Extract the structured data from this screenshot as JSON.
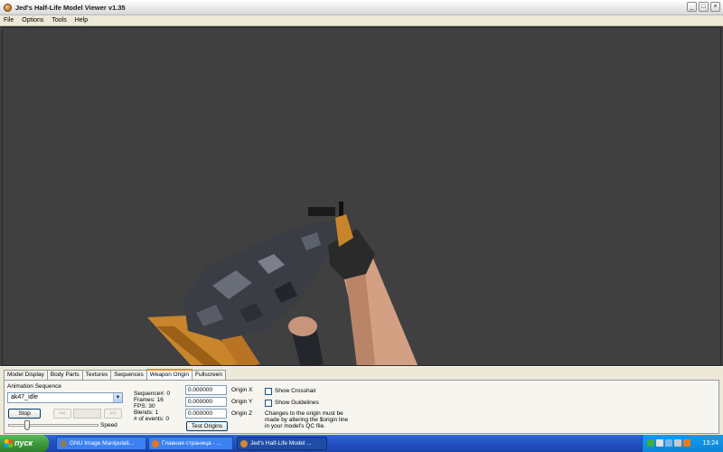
{
  "window": {
    "title": "Jed's Half-Life Model Viewer v1.35",
    "controls": [
      "_",
      "□",
      "×"
    ]
  },
  "menu": [
    "File",
    "Options",
    "Tools",
    "Help"
  ],
  "tabs": [
    "Model Display",
    "Body Parts",
    "Textures",
    "Sequences",
    "Weapon Origin",
    "Fullscreen"
  ],
  "active_tab": "Weapon Origin",
  "animation": {
    "label": "Animation Sequence",
    "selected": "ak47_idle",
    "stop_label": "Stop",
    "prev_label": "<<",
    "next_label": ">>",
    "speed_label": "Speed",
    "speed_value": 0.2
  },
  "info": {
    "sequence": "Sequence#: 0",
    "frames": "Frames: 16",
    "fps": "FPS: 30",
    "blends": "Blends: 1",
    "events": "# of events: 0"
  },
  "origin": {
    "x_value": "0.000000",
    "x_label": "Origin X",
    "y_value": "0.000000",
    "y_label": "Origin Y",
    "z_value": "0.000000",
    "z_label": "Origin Z",
    "test_label": "Test Origins"
  },
  "options": {
    "crosshair": "Show Crosshair",
    "guidelines": "Show Guidelines",
    "note_lines": [
      "Changes to the origin must be",
      "made by altering the $origin line",
      "in your model's QC file."
    ]
  },
  "taskbar": {
    "start_label": "пуск",
    "tasks": [
      {
        "label": "GNU Image Manipulati...",
        "icon": "gimp-icon"
      },
      {
        "label": "Главная страница - ...",
        "icon": "firefox-icon"
      },
      {
        "label": "Jed's Half-Life Model ...",
        "icon": "hlmv-icon"
      }
    ],
    "clock": "13:24"
  },
  "colors": {
    "viewport_bg": "#404040",
    "taskbar": "#2453c4",
    "start": "#3c9a3c"
  }
}
